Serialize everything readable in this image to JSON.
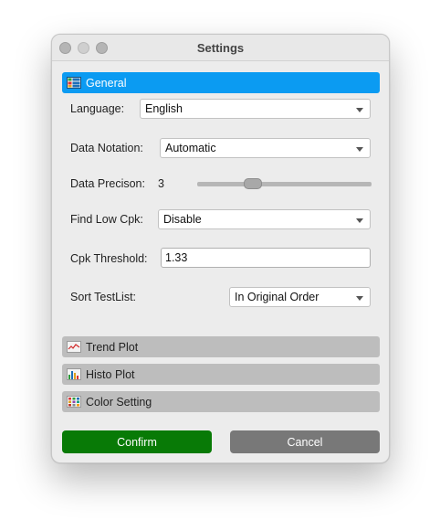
{
  "window": {
    "title": "Settings"
  },
  "sections": {
    "general": "General",
    "trend_plot": "Trend Plot",
    "histo_plot": "Histo Plot",
    "color_setting": "Color Setting"
  },
  "form": {
    "language": {
      "label": "Language:",
      "value": "English"
    },
    "data_notation": {
      "label": "Data Notation:",
      "value": "Automatic"
    },
    "data_precision": {
      "label": "Data Precison:",
      "value": "3",
      "slider_fraction": 0.3
    },
    "find_low_cpk": {
      "label": "Find Low Cpk:",
      "value": "Disable"
    },
    "cpk_threshold": {
      "label": "Cpk Threshold:",
      "value": "1.33"
    },
    "sort_testlist": {
      "label": "Sort TestList:",
      "value": "In Original Order"
    }
  },
  "buttons": {
    "confirm": "Confirm",
    "cancel": "Cancel"
  },
  "colors": {
    "accent": "#0b9bf2",
    "confirm": "#087a06",
    "cancel": "#787878"
  },
  "icons": {
    "general": "settings-grid-icon",
    "trend_plot": "trend-line-icon",
    "histo_plot": "histogram-icon",
    "color_setting": "color-palette-icon"
  }
}
